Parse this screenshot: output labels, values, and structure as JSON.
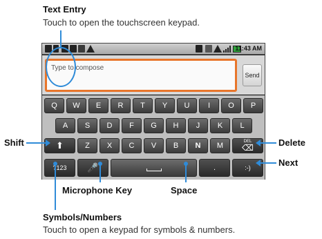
{
  "callouts": {
    "text_entry": {
      "title": "Text Entry",
      "desc": "Touch to open the touchscreen keypad."
    },
    "shift": "Shift",
    "delete": "Delete",
    "next": "Next",
    "microphone": "Microphone Key",
    "space": "Space",
    "symbols": {
      "title": "Symbols/Numbers",
      "desc": "Touch to open a keypad for symbols & numbers."
    }
  },
  "status_bar": {
    "time": "11:43 AM"
  },
  "compose": {
    "placeholder": "Type to compose",
    "send_label": "Send"
  },
  "keyboard": {
    "row1": [
      "Q",
      "W",
      "E",
      "R",
      "T",
      "Y",
      "U",
      "I",
      "O",
      "P"
    ],
    "row2": [
      "A",
      "S",
      "D",
      "F",
      "G",
      "H",
      "J",
      "K",
      "L"
    ],
    "row3": [
      "Z",
      "X",
      "C",
      "V",
      "B",
      "N",
      "M"
    ],
    "del_label": "DEL",
    "symbols_label": "?123",
    "period_label": ".",
    "smiley_label": ":-)"
  },
  "colors": {
    "accent": "#2f8bd8",
    "compose_border": "#e8752a"
  }
}
